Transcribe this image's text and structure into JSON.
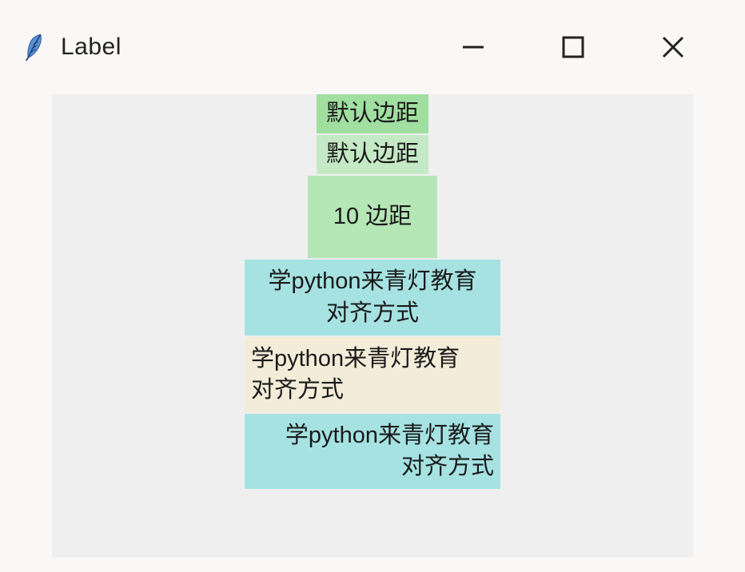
{
  "window": {
    "title": "Label"
  },
  "labels": {
    "default_padding_1": "默认边距",
    "default_padding_2": "默认边距",
    "padding_10": "10 边距",
    "multiline_center": "学python来青灯教育\n对齐方式",
    "multiline_left": "学python来青灯教育\n对齐方式",
    "multiline_right": "学python来青灯教育\n对齐方式"
  }
}
